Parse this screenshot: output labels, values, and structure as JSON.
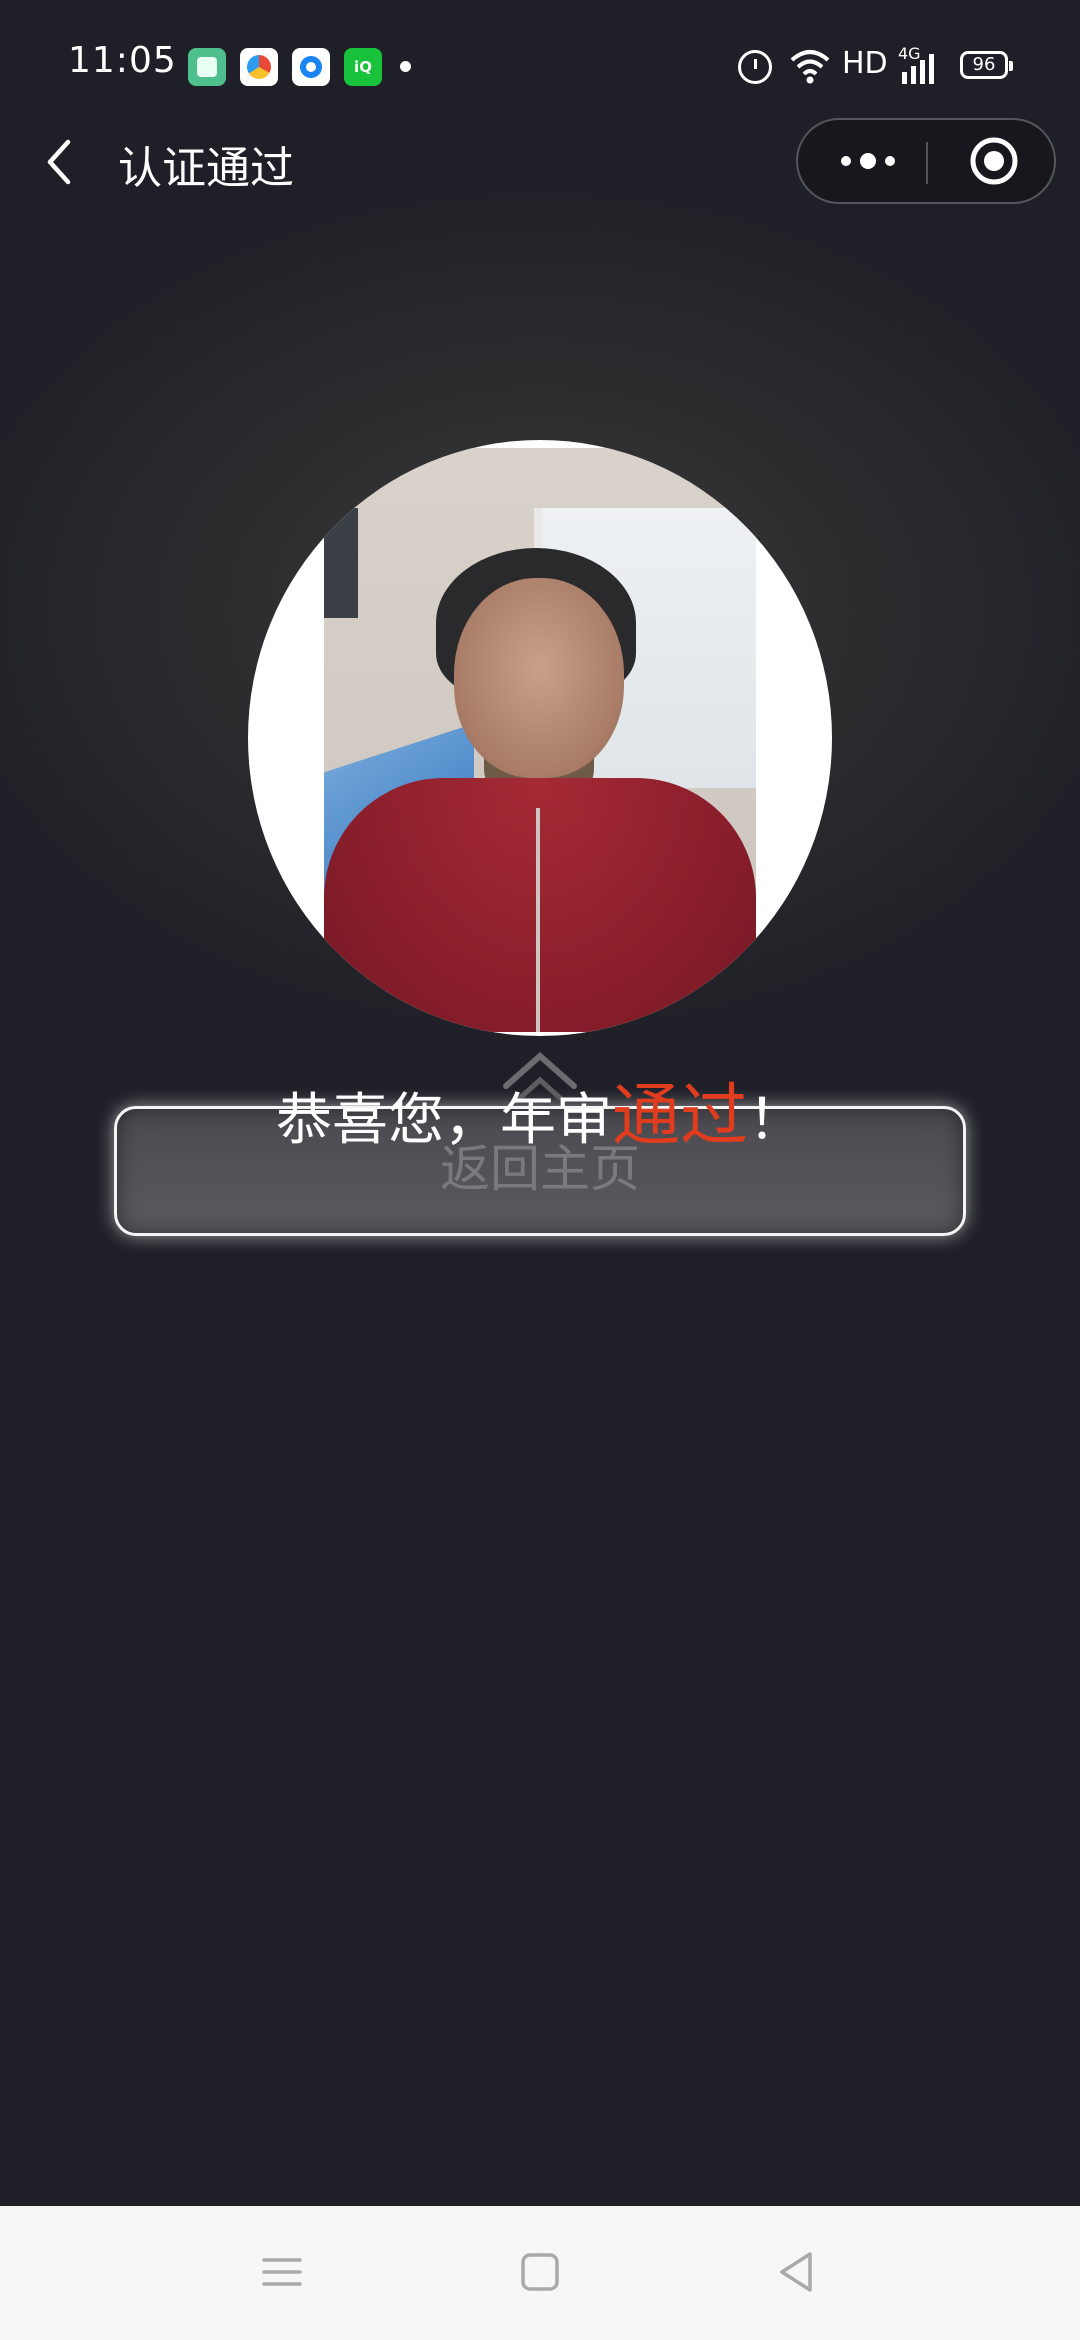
{
  "status_bar": {
    "time": "11:05",
    "network_label": "HD",
    "network_type": "4G",
    "battery": "96",
    "app_icons": [
      "green-app-icon",
      "chrome-like-icon",
      "blue-circle-app-icon",
      "iqiyi-icon"
    ]
  },
  "header": {
    "title": "认证通过"
  },
  "result": {
    "message_prefix": "恭喜您，年审",
    "message_highlight": "通过",
    "message_suffix": "！"
  },
  "actions": {
    "home_button_label": "返回主页"
  },
  "colors": {
    "background": "#1f1f27",
    "highlight": "#e23c1e",
    "button_border": "#f4f4f4",
    "system_nav_bg": "#f7f7f7"
  }
}
